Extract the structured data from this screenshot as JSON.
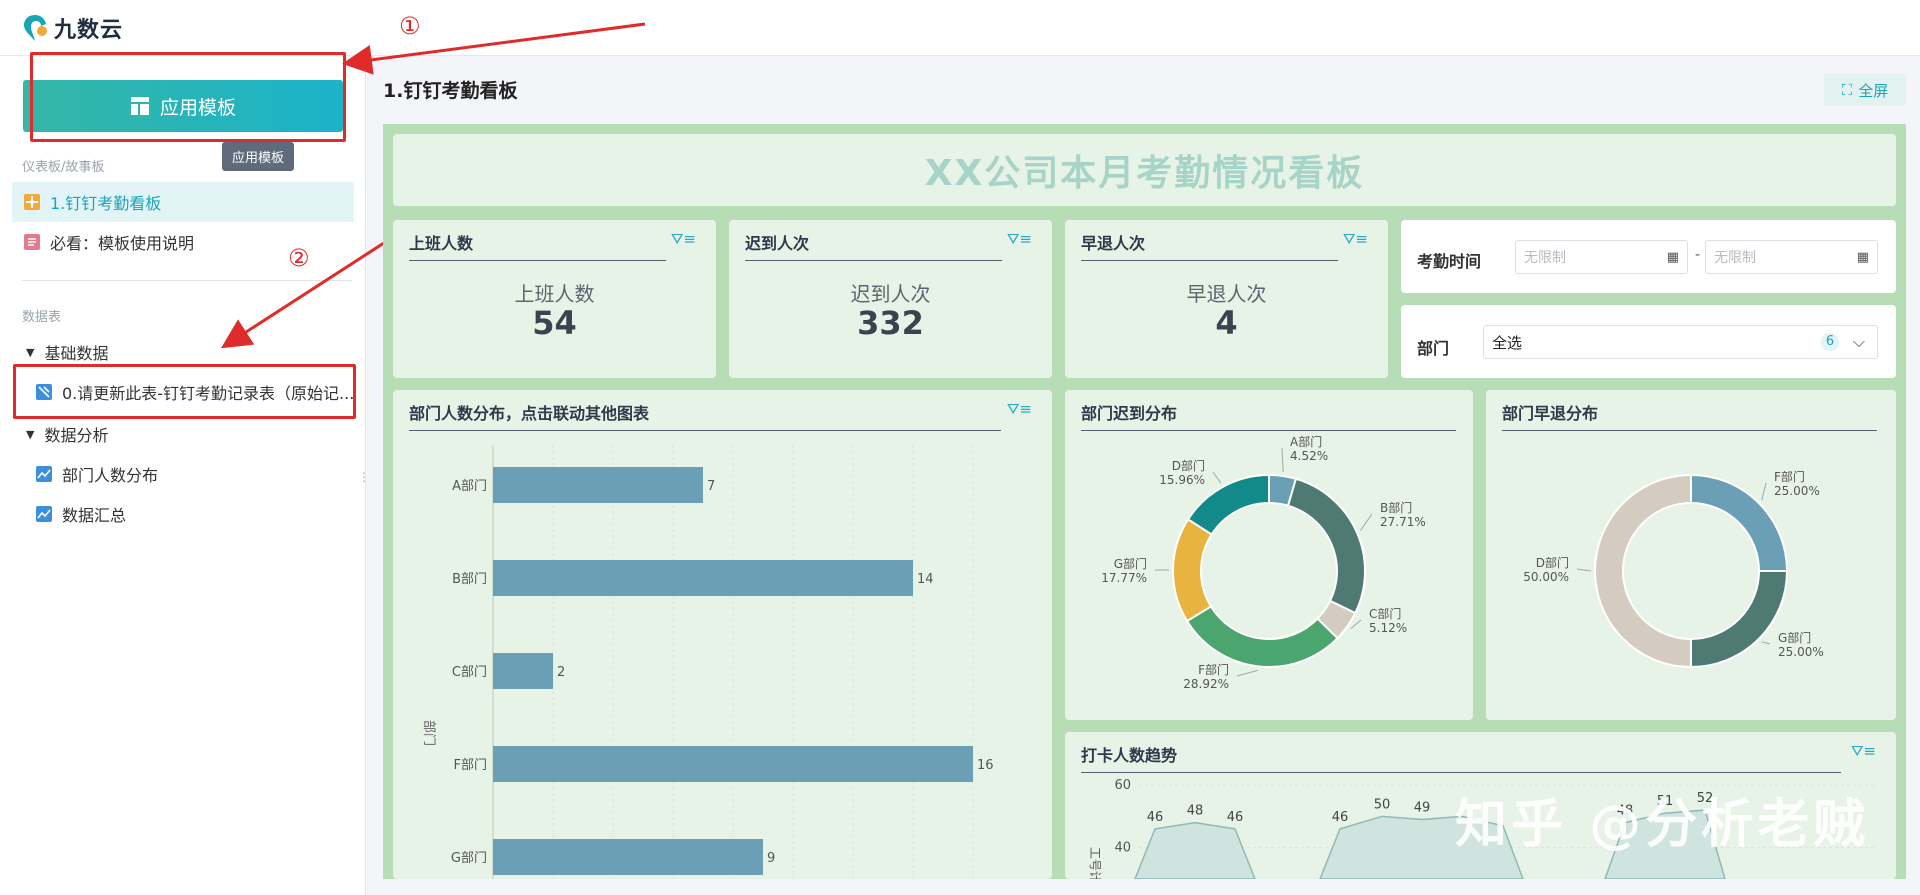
{
  "app": {
    "name": "九数云"
  },
  "sidebar": {
    "apply_button": "应用模板",
    "tooltip": "应用模板",
    "section_dashboards": "仪表板/故事板",
    "dashboards": [
      {
        "label": "1.钉钉考勤看板",
        "active": true
      },
      {
        "label": "必看：模板使用说明",
        "active": false
      }
    ],
    "section_tables": "数据表",
    "groups": [
      {
        "label": "基础数据",
        "items": [
          {
            "label": "0.请更新此表-钉钉考勤记录表（原始记..."
          }
        ]
      },
      {
        "label": "数据分析",
        "items": [
          {
            "label": "部门人数分布"
          },
          {
            "label": "数据汇总"
          }
        ]
      }
    ]
  },
  "annotations": {
    "step1": "①",
    "step2": "②"
  },
  "main": {
    "title": "1.钉钉考勤看板",
    "fullscreen_label": "全屏",
    "banner": "XX公司本月考勤情况看板",
    "kpis": [
      {
        "title": "上班人数",
        "label": "上班人数",
        "value": "54"
      },
      {
        "title": "迟到人次",
        "label": "迟到人次",
        "value": "332"
      },
      {
        "title": "早退人次",
        "label": "早退人次",
        "value": "4"
      }
    ],
    "filters": {
      "time_label": "考勤时间",
      "date_start_placeholder": "无限制",
      "date_sep": "-",
      "date_end_placeholder": "无限制",
      "dept_label": "部门",
      "dept_value": "全选",
      "dept_count": "6"
    },
    "charts_titles": {
      "dept_headcount": "部门人数分布，点击联动其他图表",
      "late": "部门迟到分布",
      "early": "部门早退分布",
      "trend": "打卡人数趋势"
    },
    "watermark": "知乎 @分析老贼"
  },
  "chart_data": [
    {
      "type": "bar",
      "orientation": "horizontal",
      "title": "部门人数分布，点击联动其他图表",
      "ylabel": "部门",
      "categories": [
        "A部门",
        "B部门",
        "C部门",
        "F部门",
        "G部门"
      ],
      "values": [
        7,
        14,
        2,
        16,
        9
      ],
      "xlim": [
        0,
        18
      ],
      "color": "#6a9fb5"
    },
    {
      "type": "pie",
      "subtype": "donut",
      "title": "部门迟到分布",
      "slices": [
        {
          "label": "A部门",
          "pct": "4.52%",
          "value": 4.52,
          "color": "#6a9fb5"
        },
        {
          "label": "B部门",
          "pct": "27.71%",
          "value": 27.71,
          "color": "#4e7a73"
        },
        {
          "label": "C部门",
          "pct": "5.12%",
          "value": 5.12,
          "color": "#d4ccc0"
        },
        {
          "label": "F部门",
          "pct": "28.92%",
          "value": 28.92,
          "color": "#4aa56e"
        },
        {
          "label": "G部门",
          "pct": "17.77%",
          "value": 17.77,
          "color": "#e8b440"
        },
        {
          "label": "D部门",
          "pct": "15.96%",
          "value": 15.96,
          "color": "#138a8a"
        }
      ]
    },
    {
      "type": "pie",
      "subtype": "donut",
      "title": "部门早退分布",
      "slices": [
        {
          "label": "F部门",
          "pct": "25.00%",
          "value": 25,
          "color": "#6a9fb5"
        },
        {
          "label": "G部门",
          "pct": "25.00%",
          "value": 25,
          "color": "#4e7a73"
        },
        {
          "label": "D部门",
          "pct": "50.00%",
          "value": 50,
          "color": "#d4ccc0"
        }
      ]
    },
    {
      "type": "area",
      "title": "打卡人数趋势",
      "ylabel": "工号计",
      "y_ticks": [
        40,
        60
      ],
      "ylim": [
        30,
        60
      ],
      "segments": [
        [
          46,
          48,
          46
        ],
        [
          46,
          50,
          49,
          50,
          47
        ],
        [
          48,
          51,
          52
        ]
      ],
      "point_labels": [
        "46",
        "48",
        "46",
        "46",
        "50",
        "49",
        "",
        "",
        "48",
        "51",
        "52"
      ]
    }
  ]
}
